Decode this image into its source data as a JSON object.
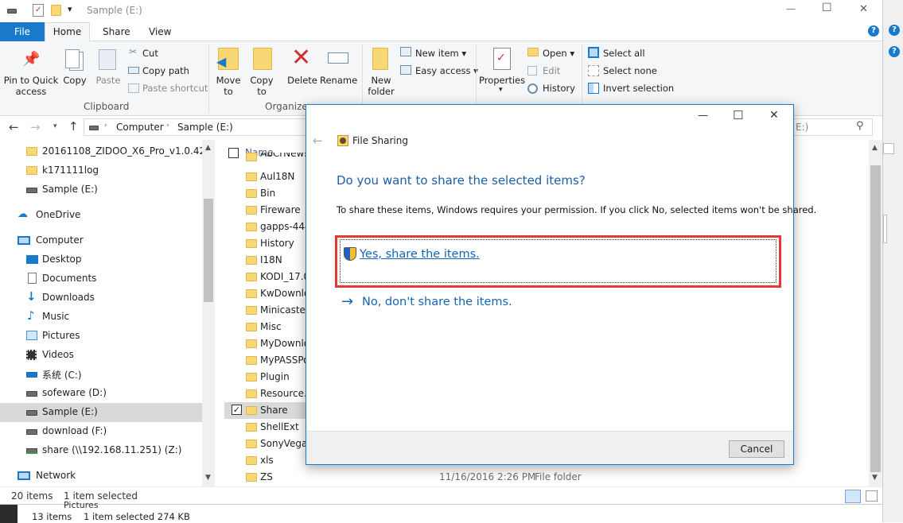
{
  "window": {
    "title": "Sample (E:)"
  },
  "qat": {
    "dropdown_glyph": "▾"
  },
  "title_controls": {
    "minimize": "—",
    "maximize": "☐",
    "close": "✕"
  },
  "ribbon_tabs": [
    {
      "label": "File"
    },
    {
      "label": "Home"
    },
    {
      "label": "Share"
    },
    {
      "label": "View"
    }
  ],
  "help_glyph": "?",
  "ribbon": {
    "pin_label": "Pin to Quick access",
    "copy_label": "Copy",
    "paste_label": "Paste",
    "cut_label": "Cut",
    "copy_path_label": "Copy path",
    "paste_shortcut_label": "Paste shortcut",
    "clipboard_group": "Clipboard",
    "move_to_label": "Move to",
    "copy_to_label": "Copy to",
    "delete_label": "Delete",
    "rename_label": "Rename",
    "organize_group": "Organize",
    "new_folder_label": "New folder",
    "new_item_label": "New item",
    "easy_access_label": "Easy access",
    "properties_label": "Properties",
    "open_label": "Open",
    "edit_label": "Edit",
    "history_label": "History",
    "select_all_label": "Select all",
    "select_none_label": "Select none",
    "invert_selection_label": "Invert selection"
  },
  "address_bar": {
    "crumbs": [
      "Computer",
      "Sample (E:)"
    ],
    "search_tail": "E:)"
  },
  "nav_pane": {
    "items": [
      {
        "label": "20161108_ZIDOO_X6_Pro_v1.0.42"
      },
      {
        "label": "k171111log"
      },
      {
        "label": "Sample (E:)"
      },
      {
        "label": "OneDrive"
      },
      {
        "label": "Computer"
      },
      {
        "label": "Desktop"
      },
      {
        "label": "Documents"
      },
      {
        "label": "Downloads"
      },
      {
        "label": "Music"
      },
      {
        "label": "Pictures"
      },
      {
        "label": "Videos"
      },
      {
        "label": "系统 (C:)"
      },
      {
        "label": "sofeware (D:)"
      },
      {
        "label": "Sample (E:)"
      },
      {
        "label": "download (F:)"
      },
      {
        "label": "share (\\\\192.168.11.251) (Z:)"
      },
      {
        "label": "Network"
      }
    ]
  },
  "file_list": {
    "column_name": "Name",
    "items": [
      "AbCrNews",
      "Aul18N",
      "Bin",
      "Fireware",
      "gapps-444-",
      "History",
      "I18N",
      "KODI_17.0",
      "KwDownlo",
      "Minicaster",
      "Misc",
      "MyDownlo",
      "MyPASSPo",
      "Plugin",
      "Resource.8",
      "Share",
      "ShellExt",
      "SonyVegas",
      "xls",
      "ZS"
    ],
    "zs_date": "11/16/2016 2:26 PM",
    "zs_type": "File folder"
  },
  "status_bar": {
    "item_count": "20 items",
    "selected": "1 item selected"
  },
  "behind_window": {
    "item_count": "13 items",
    "selected": "1 item selected  274 KB",
    "text": "Pictures"
  },
  "dialog": {
    "title": "File Sharing",
    "heading": "Do you want to share the selected items?",
    "message": "To share these items, Windows requires your permission. If you click No, selected items won't be shared.",
    "yes_option": "Yes, share the items.",
    "no_option": "No, don't share the items.",
    "cancel_label": "Cancel",
    "highlight_color": "#e53935"
  }
}
